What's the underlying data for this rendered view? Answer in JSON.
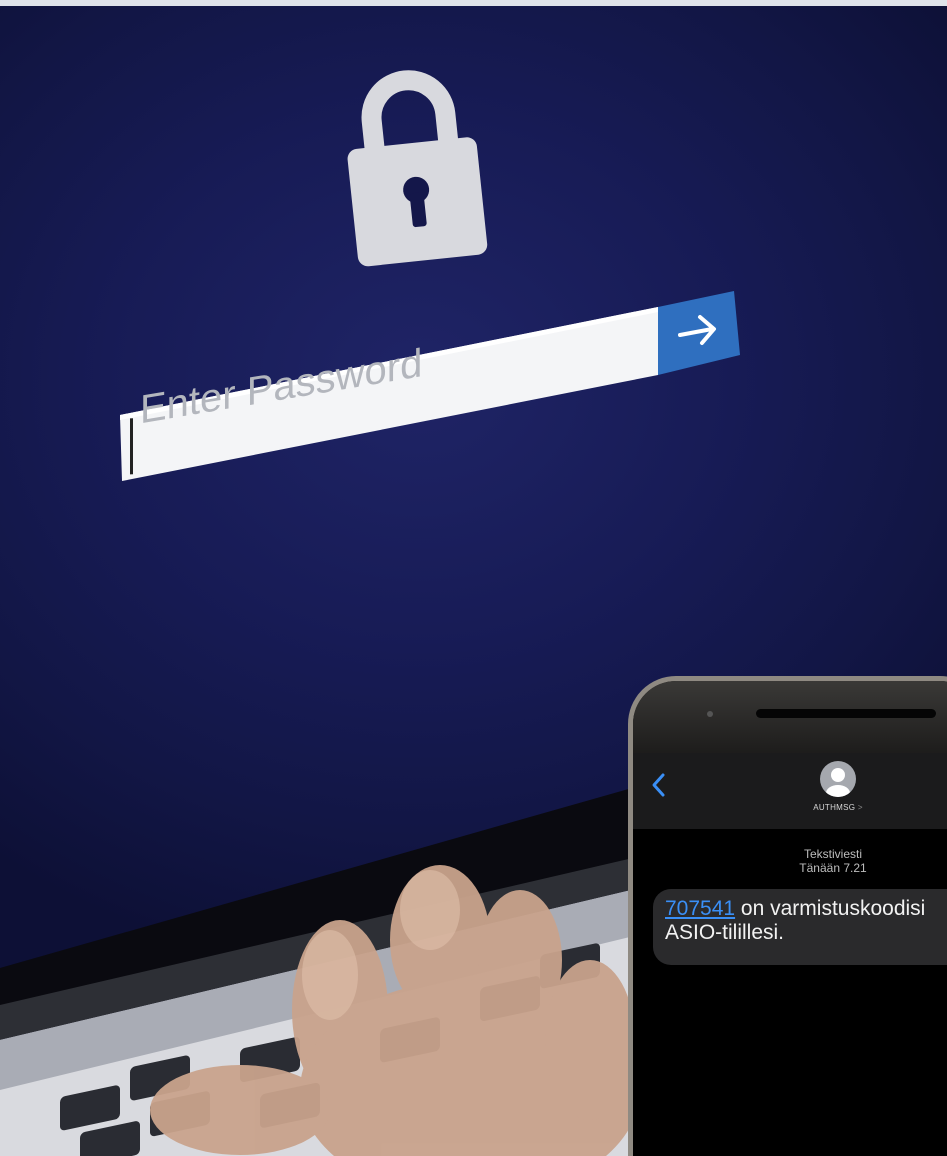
{
  "laptop": {
    "password_placeholder": "Enter Password",
    "submit_icon": "arrow-right-icon",
    "lock_icon": "padlock-icon",
    "colors": {
      "screen_bg": "#171b55",
      "submit_bg": "#2f6fbf",
      "lock": "#d8d9de"
    }
  },
  "phone": {
    "sender": "AUTHMSG",
    "sender_chevron": ">",
    "message_type": "Tekstiviesti",
    "timestamp": "Tänään 7.21",
    "code": "707541",
    "message_line1": "on varmistuskoodisi",
    "message_line2": "ASIO-tilillesi.",
    "colors": {
      "link": "#3a8ff6",
      "bubble": "#2a2a2c",
      "back_icon": "#3a8ff6"
    }
  }
}
